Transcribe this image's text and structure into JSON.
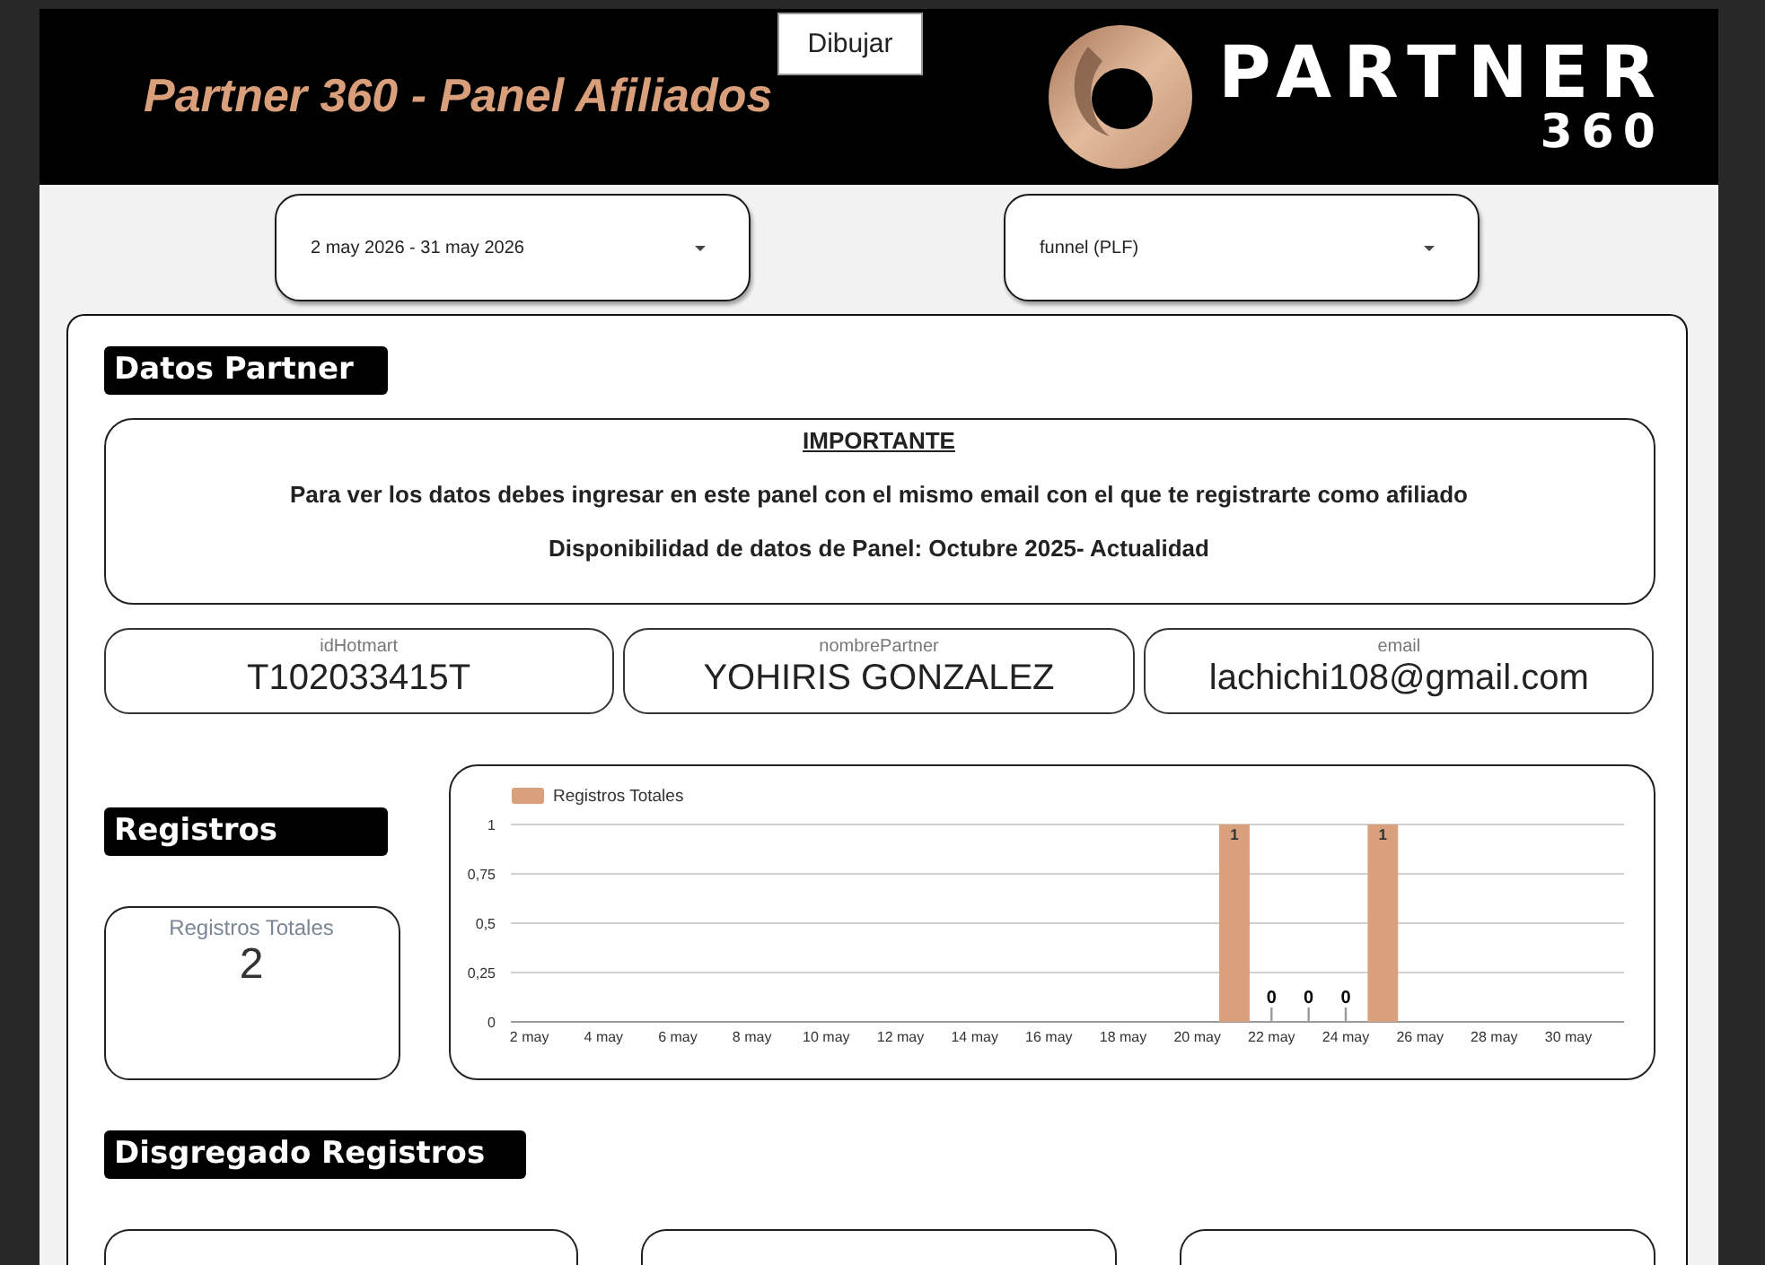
{
  "header": {
    "title": "Partner 360 - Panel Afiliados",
    "logo_word": "PARTNER",
    "logo_number": "360",
    "draw_button": "Dibujar"
  },
  "filters": [
    {
      "value": "2 may 2026 - 31 may 2026"
    },
    {
      "value": "funnel (PLF)"
    }
  ],
  "partner_section": {
    "heading": "Datos Partner",
    "notice": {
      "title": "IMPORTANTE",
      "lines": [
        "Para ver los datos debes ingresar en este panel con el mismo email con el que te registrarte como afiliado",
        "Disponibilidad de datos de Panel: Octubre 2025- Actualidad"
      ]
    },
    "fields": [
      {
        "label": "idHotmart",
        "value": "T102033415T"
      },
      {
        "label": "nombrePartner",
        "value": "YOHIRIS GONZALEZ"
      },
      {
        "label": "email",
        "value": "lachichi108@gmail.com"
      }
    ]
  },
  "registros_section": {
    "heading": "Registros",
    "scorecard": {
      "label": "Registros Totales",
      "value": "2"
    },
    "chart_data": {
      "type": "bar",
      "categories": [
        "2 may",
        null,
        "4 may",
        null,
        "6 may",
        null,
        "8 may",
        null,
        "10 may",
        null,
        "12 may",
        null,
        "14 may",
        null,
        "16 may",
        null,
        "18 may",
        null,
        "20 may",
        null,
        "22 may",
        null,
        "24 may",
        null,
        "26 may",
        null,
        "28 may",
        null,
        "30 may",
        null
      ],
      "series": [
        {
          "name": "Registros Totales",
          "color": "#d8a07c",
          "values": [
            null,
            null,
            null,
            null,
            null,
            null,
            null,
            null,
            null,
            null,
            null,
            null,
            null,
            null,
            null,
            null,
            null,
            null,
            null,
            1,
            0,
            0,
            0,
            1,
            null,
            null,
            null,
            null,
            null,
            null
          ]
        }
      ],
      "ylim": [
        0,
        1
      ],
      "yticks": [
        0,
        {
          "value": 0.25,
          "label": "0,25"
        },
        {
          "value": 0.5,
          "label": "0,5"
        },
        {
          "value": 0.75,
          "label": "0,75"
        },
        1
      ],
      "grid": true,
      "data_labels": true
    }
  },
  "disgregado_section": {
    "heading": "Disgregado Registros"
  }
}
